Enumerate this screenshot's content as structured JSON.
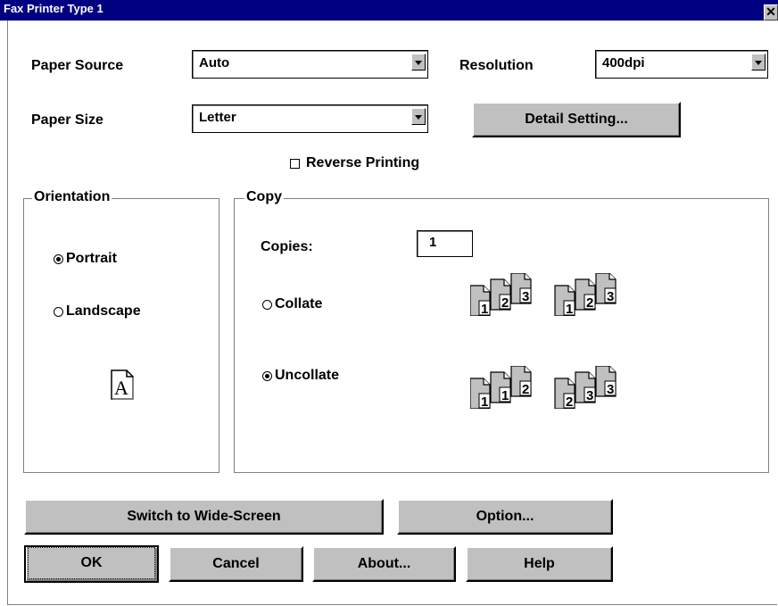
{
  "window": {
    "title": "Fax Printer Type 1",
    "close_glyph": "✕"
  },
  "paper_source": {
    "label": "Paper Source",
    "value": "Auto"
  },
  "resolution": {
    "label": "Resolution",
    "value": "400dpi"
  },
  "paper_size": {
    "label": "Paper Size",
    "value": "Letter"
  },
  "detail_setting_button": "Detail Setting...",
  "reverse_printing": {
    "label": "Reverse Printing",
    "checked": false
  },
  "orientation": {
    "title": "Orientation",
    "portrait_label": "Portrait",
    "landscape_label": "Landscape",
    "selected": "Portrait",
    "preview_letter": "A"
  },
  "copy": {
    "title": "Copy",
    "copies_label": "Copies:",
    "copies_value": "1",
    "collate_label": "Collate",
    "uncollate_label": "Uncollate",
    "selected": "Uncollate",
    "collate_pages": [
      "1",
      "2",
      "3",
      "1",
      "2",
      "3"
    ],
    "uncollate_pages": [
      "1",
      "1",
      "2",
      "2",
      "3",
      "3"
    ]
  },
  "buttons": {
    "switch_wide": "Switch to Wide-Screen",
    "option": "Option...",
    "ok": "OK",
    "cancel": "Cancel",
    "about": "About...",
    "help": "Help"
  },
  "colors": {
    "titlebar": "#000080",
    "face": "#c0c0c0"
  }
}
